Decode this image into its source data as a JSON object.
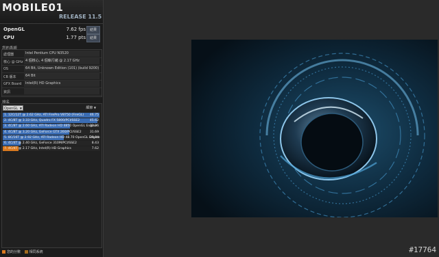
{
  "header": {
    "logo": "MOBILE01",
    "release": "RELEASE 11.5"
  },
  "scores": [
    {
      "label": "OpenGL",
      "value": "7.62 fps",
      "button": "結果"
    },
    {
      "label": "CPU",
      "value": "1.77 pts",
      "button": "結果"
    }
  ],
  "system": {
    "title": "您的系統",
    "rows": [
      {
        "key": "處理器",
        "value": "Intel Pentium CPU N3520"
      },
      {
        "key": "核心 @ GHz",
        "value": "4 個核心, 4 個執行緒 @ 2.17 GHz"
      },
      {
        "key": "OS",
        "value": "64 Bit, Unknown Edition (101) (build 9200)"
      },
      {
        "key": "CB 版本",
        "value": "64 Bit"
      },
      {
        "key": "GFX Board",
        "value": "Intel(R) HD Graphics"
      },
      {
        "key": "資訊",
        "value": ""
      }
    ]
  },
  "ranking": {
    "title": "排名",
    "dropdown": "OpenGL",
    "details_label": "細節",
    "rows": [
      {
        "text": "1. 12C/12T @ 2.62 GHz, ATI FirePro V8750 (FireGL)",
        "score": "46.75",
        "fill": 0.99,
        "color": "#3b6db4"
      },
      {
        "text": "2. 4C/8T @ 3.33 GHz, Quadro FX 5800/PCI/SSE2",
        "score": "45.62",
        "fill": 0.97,
        "color": "#3b6db4"
      },
      {
        "text": "3. 4C/8T @ 2.60 GHz, ATI Radeon HD 4850 OpenGL Engine",
        "score": "32.26",
        "fill": 0.69,
        "color": "#3b6db4"
      },
      {
        "text": "4. 4C/8T @ 3.20 GHz, GeForce GTX 260/PCI/SSE2",
        "score": "31.69",
        "fill": 0.68,
        "color": "#3b6db4"
      },
      {
        "text": "5. 8C/16T @ 2.92 GHz, ATI Radeon HD 48.70 OpenGL Engine",
        "score": "29.44",
        "fill": 0.63,
        "color": "#3b6db4"
      },
      {
        "text": "6. 4C/4T @ 2.40 GHz, GeForce 310M/PCI/SSE2",
        "score": "8.43",
        "fill": 0.18,
        "color": "#3b6db4"
      },
      {
        "text": "7. 4C/4T @ 2.17 GHz, Intel(R) HD Graphics",
        "score": "7.62",
        "fill": 0.16,
        "color": "#d9791f"
      }
    ]
  },
  "legend": {
    "my_score": "您的分數",
    "identical": "相同系統",
    "my_score_color": "#d9791f",
    "identical_color": "#a36a1e"
  },
  "watermark": "#17764"
}
